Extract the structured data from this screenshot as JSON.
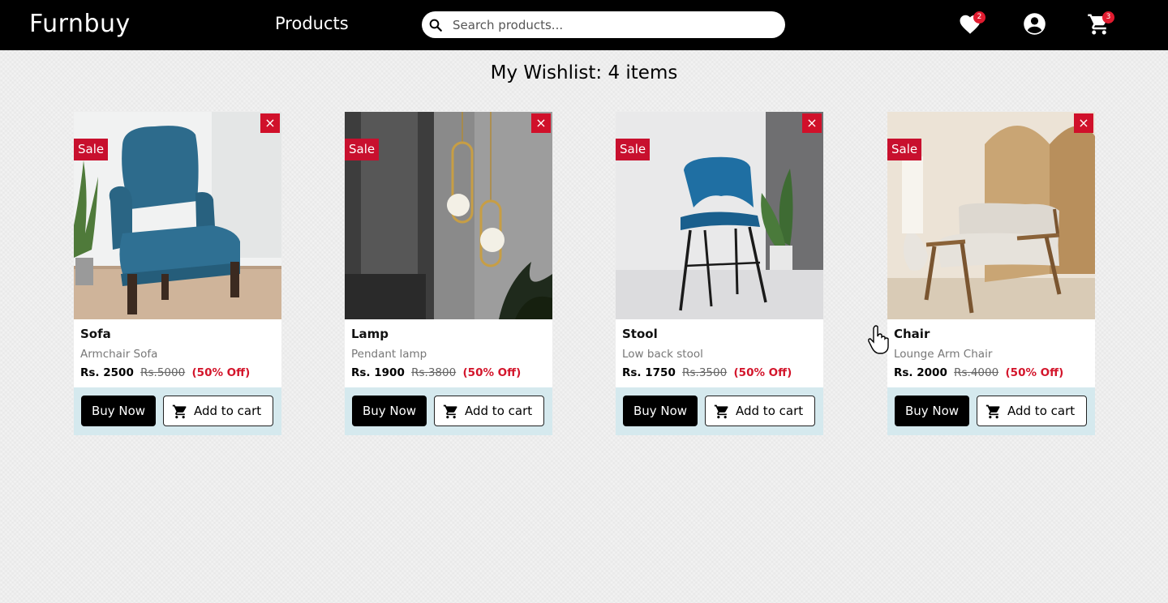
{
  "header": {
    "brand": "Furnbuy",
    "nav_products": "Products",
    "search_placeholder": "Search products...",
    "wishlist_count": "2",
    "cart_count": "3",
    "icons": [
      "search-icon",
      "heart-icon",
      "account-icon",
      "cart-icon"
    ]
  },
  "page": {
    "title": "My Wishlist: 4 items"
  },
  "colors": {
    "sale_badge": "#c8102e",
    "discount_text": "#d3152b",
    "actions_bg": "#d5e9ee",
    "navbar": "#000000"
  },
  "products": [
    {
      "sale_label": "Sale",
      "remove_label": "×",
      "name": "Sofa",
      "description": "Armchair Sofa",
      "price": "Rs. 2500",
      "old_price": "Rs.5000",
      "discount": "(50% Off)",
      "buy_label": "Buy Now",
      "cart_label": "Add to cart"
    },
    {
      "sale_label": "Sale",
      "remove_label": "×",
      "name": "Lamp",
      "description": "Pendant lamp",
      "price": "Rs. 1900",
      "old_price": "Rs.3800",
      "discount": "(50% Off)",
      "buy_label": "Buy Now",
      "cart_label": "Add to cart"
    },
    {
      "sale_label": "Sale",
      "remove_label": "×",
      "name": "Stool",
      "description": "Low back stool",
      "price": "Rs. 1750",
      "old_price": "Rs.3500",
      "discount": "(50% Off)",
      "buy_label": "Buy Now",
      "cart_label": "Add to cart"
    },
    {
      "sale_label": "Sale",
      "remove_label": "×",
      "name": "Chair",
      "description": "Lounge Arm Chair",
      "price": "Rs. 2000",
      "old_price": "Rs.4000",
      "discount": "(50% Off)",
      "buy_label": "Buy Now",
      "cart_label": "Add to cart"
    }
  ]
}
